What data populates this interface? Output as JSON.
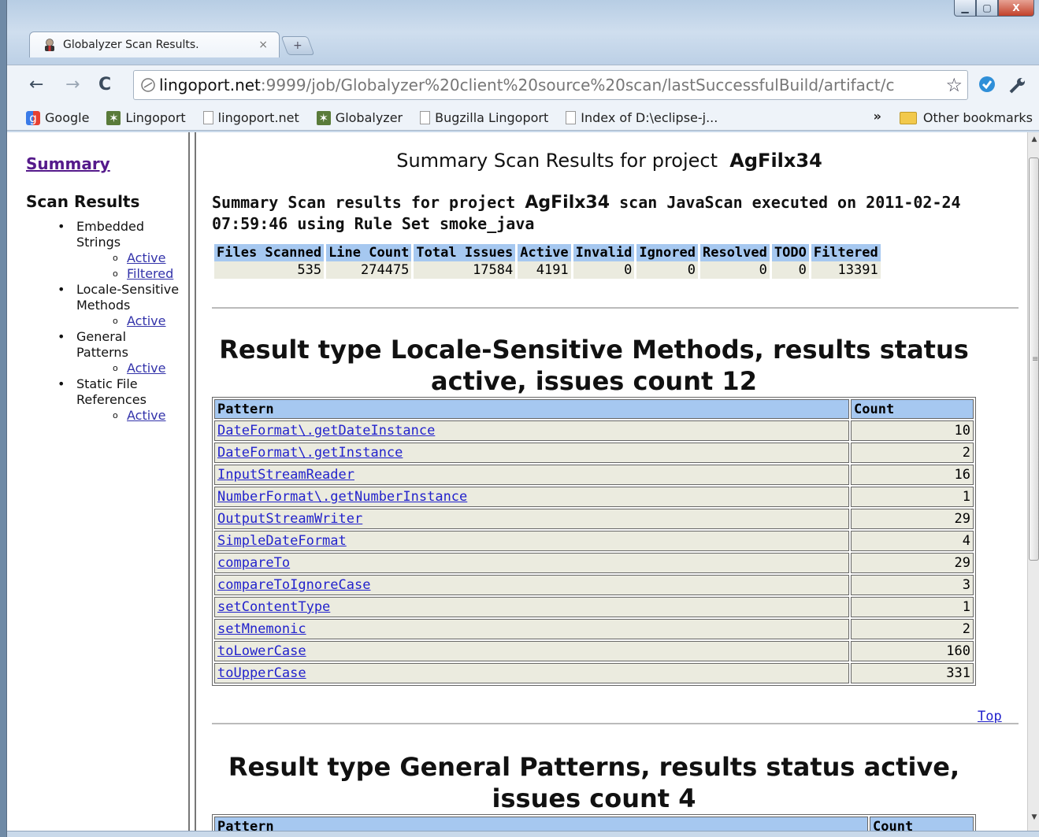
{
  "tab": {
    "title": "Globalyzer Scan Results.",
    "close": "×"
  },
  "window": {
    "min": "▁",
    "max": "▢",
    "close": "X"
  },
  "toolbar": {
    "back": "←",
    "forward": "→",
    "reload": "C",
    "url_host": "lingoport.net",
    "url_path": ":9999/job/Globalyzer%20client%20source%20scan/lastSuccessfulBuild/artifact/c",
    "star": "☆"
  },
  "bookmarks": {
    "items": [
      "Google",
      "Lingoport",
      "lingoport.net",
      "Globalyzer",
      "Bugzilla Lingoport",
      "Index of D:\\eclipse-j..."
    ],
    "overflow": "»",
    "other": "Other bookmarks"
  },
  "sidebar": {
    "summary": "Summary",
    "scan_results": "Scan Results",
    "groups": [
      {
        "label": "Embedded Strings",
        "links": [
          "Active",
          "Filtered"
        ]
      },
      {
        "label": "Locale-Sensitive Methods",
        "links": [
          "Active"
        ]
      },
      {
        "label": "General Patterns",
        "links": [
          "Active"
        ]
      },
      {
        "label": "Static File References",
        "links": [
          "Active"
        ]
      }
    ]
  },
  "main": {
    "title_prefix": "Summary Scan Results for project",
    "project": "AgFilx34",
    "subtitle_prefix": "Summary Scan results for project",
    "subtitle_suffix": "scan JavaScan executed on 2011-02-24 07:59:46 using Rule Set smoke_java",
    "summary_headers": [
      "Files Scanned",
      "Line Count",
      "Total Issues",
      "Active",
      "Invalid",
      "Ignored",
      "Resolved",
      "TODO",
      "Filtered"
    ],
    "summary_values": [
      "535",
      "274475",
      "17584",
      "4191",
      "0",
      "0",
      "0",
      "0",
      "13391"
    ],
    "section1_title": "Result type Locale-Sensitive Methods, results status active, issues count 12",
    "col_pattern": "Pattern",
    "col_count": "Count",
    "rows": [
      {
        "pattern": "DateFormat\\.getDateInstance",
        "count": "10"
      },
      {
        "pattern": "DateFormat\\.getInstance",
        "count": "2"
      },
      {
        "pattern": "InputStreamReader",
        "count": "16"
      },
      {
        "pattern": "NumberFormat\\.getNumberInstance",
        "count": "1"
      },
      {
        "pattern": "OutputStreamWriter",
        "count": "29"
      },
      {
        "pattern": "SimpleDateFormat",
        "count": "4"
      },
      {
        "pattern": "compareTo",
        "count": "29"
      },
      {
        "pattern": "compareToIgnoreCase",
        "count": "3"
      },
      {
        "pattern": "setContentType",
        "count": "1"
      },
      {
        "pattern": "setMnemonic",
        "count": "2"
      },
      {
        "pattern": "toLowerCase",
        "count": "160"
      },
      {
        "pattern": "toUpperCase",
        "count": "331"
      }
    ],
    "top_link": "Top",
    "section2_title": "Result type General Patterns, results status active, issues count 4"
  }
}
